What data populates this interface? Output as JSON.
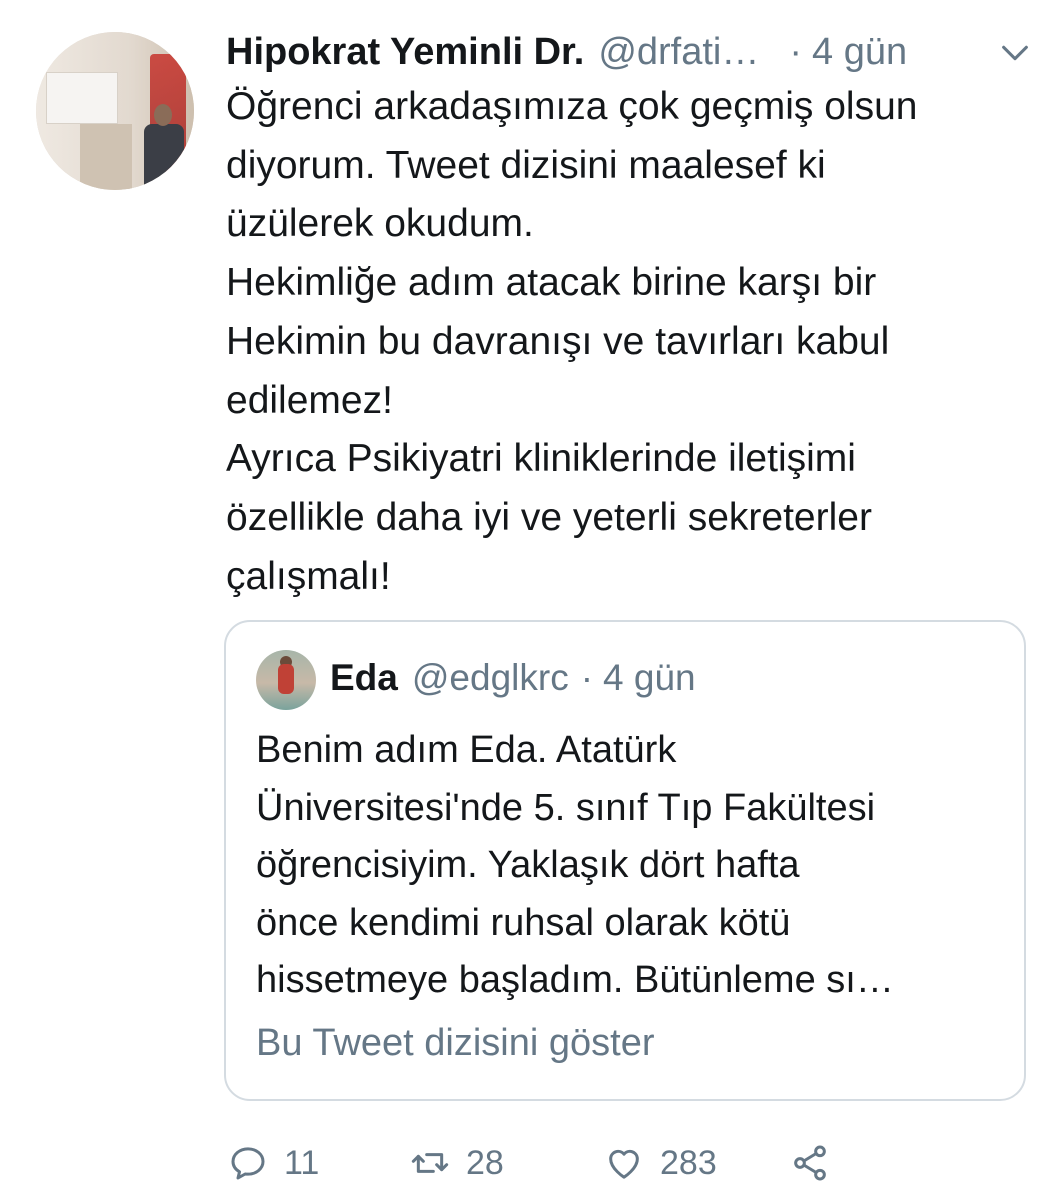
{
  "tweet": {
    "author_name": "Hipokrat Yeminli Dr.",
    "handle": "@drfati…",
    "separator": "·",
    "time": "4 gün",
    "lines": [
      "Öğrenci arkadaşımıza çok geçmiş olsun",
      "diyorum. Tweet dizisini maalesef ki",
      "üzülerek okudum.",
      "Hekimliğe adım atacak birine karşı bir",
      "Hekimin bu davranışı ve tavırları kabul",
      "edilemez!",
      "Ayrıca Psikiyatri kliniklerinde iletişimi",
      "özellikle daha iyi ve yeterli sekreterler",
      "çalışmalı!"
    ]
  },
  "quoted": {
    "author_name": "Eda",
    "handle": "@edglkrc",
    "separator": "·",
    "time": "4 gün",
    "lines": [
      "Benim adım Eda. Atatürk",
      "Üniversitesi'nde 5. sınıf Tıp Fakültesi",
      "öğrencisiyim. Yaklaşık dört hafta",
      "önce kendimi ruhsal olarak kötü",
      "hissetmeye başladım. Bütünleme sı…"
    ],
    "show_thread_label": "Bu Tweet dizisini göster"
  },
  "actions": {
    "reply_count": "11",
    "retweet_count": "28",
    "like_count": "283"
  },
  "icons": {
    "reply": "reply-icon",
    "retweet": "retweet-icon",
    "like": "heart-icon",
    "share": "share-icon",
    "menu": "chevron-down-icon"
  },
  "colors": {
    "text": "#14171a",
    "secondary": "#657786",
    "border": "#d4dbe1"
  }
}
